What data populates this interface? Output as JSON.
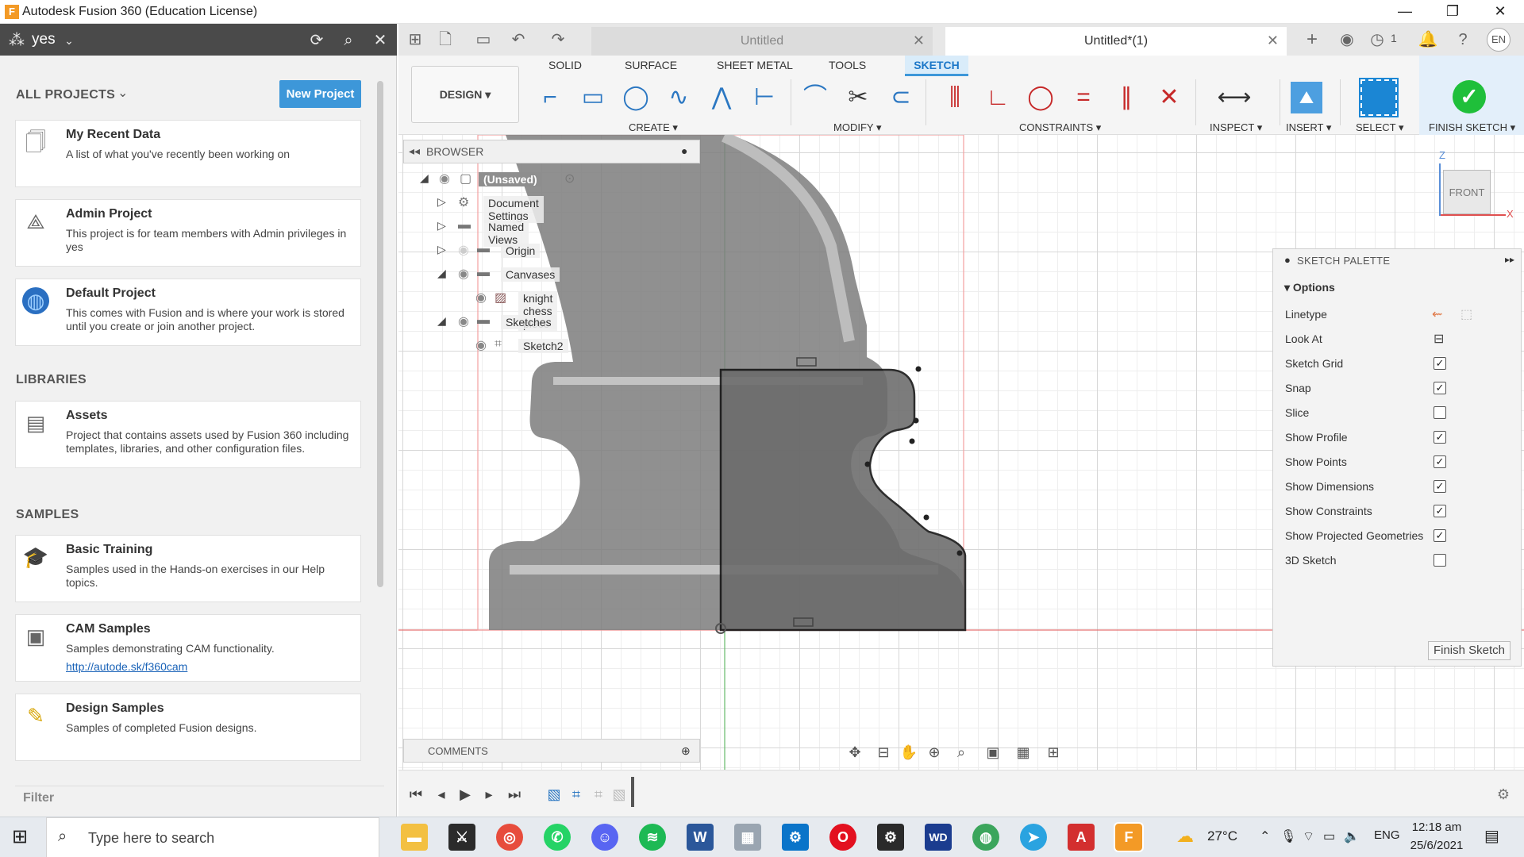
{
  "window": {
    "title": "Autodesk Fusion 360 (Education License)",
    "logo_letter": "F"
  },
  "data_panel": {
    "team_name": "yes",
    "all_projects_label": "ALL PROJECTS",
    "new_project_label": "New Project",
    "projects": [
      {
        "title": "My Recent Data",
        "desc": "A list of what you've recently been working on"
      },
      {
        "title": "Admin Project",
        "desc": "This project is for team members with Admin privileges in yes"
      },
      {
        "title": "Default Project",
        "desc": "This comes with Fusion and is where your work is stored until you create or join another project."
      }
    ],
    "libraries_label": "LIBRARIES",
    "libraries": [
      {
        "title": "Assets",
        "desc": "Project that contains assets used by Fusion 360 including templates, libraries, and other configuration files."
      }
    ],
    "samples_label": "SAMPLES",
    "samples": [
      {
        "title": "Basic Training",
        "desc": "Samples used in the Hands-on exercises in our Help topics."
      },
      {
        "title": "CAM Samples",
        "desc": "Samples demonstrating CAM functionality.",
        "link": "http://autode.sk/f360cam"
      },
      {
        "title": "Design Samples",
        "desc": "Samples of completed Fusion designs."
      }
    ],
    "filter_placeholder": "Filter"
  },
  "tabs": [
    {
      "label": "Untitled",
      "active": false
    },
    {
      "label": "Untitled*(1)",
      "active": true
    }
  ],
  "quick_access": {
    "job_count": "1",
    "avatar_initials": "EN"
  },
  "toolbar": {
    "workspace": "DESIGN",
    "tabs": [
      "SOLID",
      "SURFACE",
      "SHEET METAL",
      "TOOLS",
      "SKETCH"
    ],
    "active_tab": "SKETCH",
    "groups": {
      "create": "CREATE",
      "modify": "MODIFY",
      "constraints": "CONSTRAINTS",
      "inspect": "INSPECT",
      "insert": "INSERT",
      "select": "SELECT",
      "finish": "FINISH SKETCH"
    }
  },
  "browser": {
    "title": "BROWSER",
    "items": [
      {
        "label": "(Unsaved)"
      },
      {
        "label": "Document Settings"
      },
      {
        "label": "Named Views"
      },
      {
        "label": "Origin"
      },
      {
        "label": "Canvases"
      },
      {
        "label": "knight chess piece"
      },
      {
        "label": "Sketches"
      },
      {
        "label": "Sketch2"
      }
    ]
  },
  "viewcube": {
    "face": "FRONT",
    "axis_z": "Z",
    "axis_x": "X"
  },
  "sketch_palette": {
    "title": "SKETCH PALETTE",
    "options_label": "Options",
    "rows": [
      {
        "label": "Linetype",
        "type": "icons"
      },
      {
        "label": "Look At",
        "type": "icon"
      },
      {
        "label": "Sketch Grid",
        "checked": true
      },
      {
        "label": "Snap",
        "checked": true
      },
      {
        "label": "Slice",
        "checked": false
      },
      {
        "label": "Show Profile",
        "checked": true
      },
      {
        "label": "Show Points",
        "checked": true
      },
      {
        "label": "Show Dimensions",
        "checked": true
      },
      {
        "label": "Show Constraints",
        "checked": true
      },
      {
        "label": "Show Projected Geometries",
        "checked": true
      },
      {
        "label": "3D Sketch",
        "checked": false
      }
    ],
    "finish_button": "Finish Sketch"
  },
  "comments": {
    "label": "COMMENTS"
  },
  "taskbar": {
    "search_placeholder": "Type here to search",
    "temperature": "27°C",
    "language": "ENG",
    "time": "12:18 am",
    "date": "25/6/2021"
  },
  "colors": {
    "accent": "#3d97d9",
    "sketch_tab": "#1c77c8",
    "finish_green": "#1fbf3a",
    "profile_gray": "#6b6b6b",
    "canvas_image_gray": "#7d7d7d",
    "axis_red": "#e57373",
    "axis_green": "#66bb6a"
  }
}
